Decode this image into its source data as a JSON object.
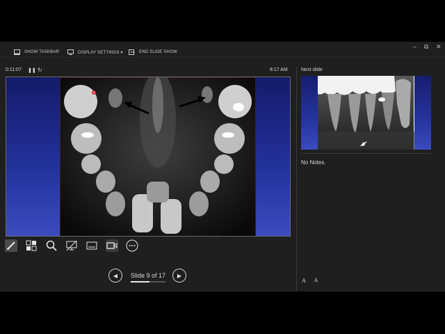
{
  "window": {
    "minimize_glyph": "–",
    "maximize_glyph": "⧉",
    "close_glyph": "✕"
  },
  "toolbar": {
    "show_taskbar": "SHOW TASKBAR",
    "display_settings": "DISPLAY SETTINGS ▾",
    "end_slide_show": "END SLIDE SHOW"
  },
  "presenter": {
    "timer": "0:11:07",
    "pause_glyph": "❚❚",
    "restart_glyph": "↻",
    "clock": "8:17 AM"
  },
  "tools": [
    {
      "name": "pen-tool",
      "icon": "pen-icon"
    },
    {
      "name": "see-all-slides",
      "icon": "slides-grid-icon"
    },
    {
      "name": "zoom",
      "icon": "magnifier-icon"
    },
    {
      "name": "black-screen",
      "icon": "monitor-off-icon"
    },
    {
      "name": "subtitles",
      "icon": "subtitles-icon"
    },
    {
      "name": "camera",
      "icon": "camera-icon"
    },
    {
      "name": "more-options",
      "icon": "ellipsis-icon"
    }
  ],
  "navigation": {
    "prev_glyph": "◀",
    "next_glyph": "▶",
    "slide_counter": "Slide 9 of 17",
    "progress_fraction": 0.53
  },
  "next_pane": {
    "label": "Next slide",
    "notes": "No Notes."
  },
  "notes_font": {
    "increase_glyph": "A",
    "decrease_glyph": "A"
  },
  "colors": {
    "background": "#1f1f1f",
    "slide_blue_top": "#141c6a",
    "slide_blue_bottom": "#3b4cc0",
    "laser_pointer": "#e0202a",
    "slide_frame": "#7a2a3a"
  }
}
